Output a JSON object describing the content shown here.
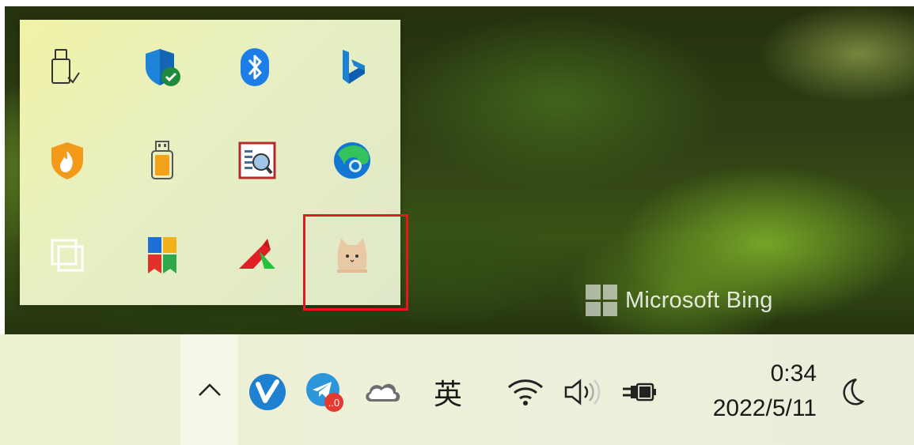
{
  "wallpaper": {
    "watermark_text": "Microsoft Bing"
  },
  "tray_flyout": {
    "icons": [
      {
        "name": "safely-remove-hardware-icon"
      },
      {
        "name": "windows-security-icon"
      },
      {
        "name": "bluetooth-icon"
      },
      {
        "name": "bing-icon"
      },
      {
        "name": "security-shield-flame-icon"
      },
      {
        "name": "usb-drive-icon"
      },
      {
        "name": "document-search-icon"
      },
      {
        "name": "edge-icon"
      },
      {
        "name": "copy-windows-icon"
      },
      {
        "name": "bookmark-app-icon"
      },
      {
        "name": "red-arrow-app-icon"
      },
      {
        "name": "cat-app-icon"
      }
    ],
    "highlighted_icon": "cat-app-icon"
  },
  "taskbar": {
    "chevron": "chevron-up-icon",
    "icons": [
      "v-app-icon",
      "telegram-icon",
      "onedrive-icon"
    ],
    "telegram_badge": "..0",
    "ime_label": "英",
    "status_icons": [
      "wifi-icon",
      "volume-icon",
      "battery-charging-icon"
    ],
    "clock": {
      "time": "0:34",
      "date": "2022/5/11"
    },
    "focus_icon": "moon-icon"
  },
  "colors": {
    "highlight": "#e3191f",
    "taskbar_bg": "#eef1d0",
    "flyout_bg": "#e7efc3"
  }
}
